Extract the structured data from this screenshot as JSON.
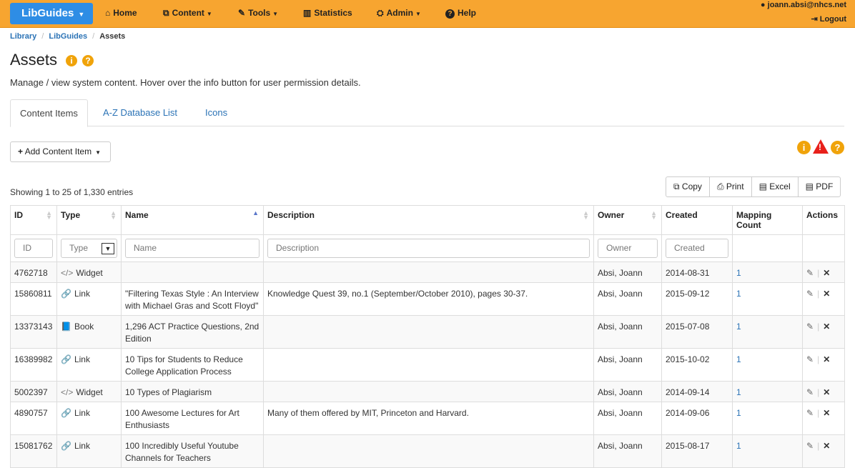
{
  "navbar": {
    "brand": "LibGuides",
    "items": [
      {
        "label": "Home",
        "icon": "home-icon",
        "glyph": "⌂"
      },
      {
        "label": "Content",
        "icon": "content-icon",
        "glyph": "⧉",
        "caret": true
      },
      {
        "label": "Tools",
        "icon": "wrench-icon",
        "glyph": "✎",
        "caret": true
      },
      {
        "label": "Statistics",
        "icon": "bar-chart-icon",
        "glyph": "▥"
      },
      {
        "label": "Admin",
        "icon": "sitemap-icon",
        "glyph": "⛭",
        "caret": true
      },
      {
        "label": "Help",
        "icon": "help-icon",
        "glyph": "?"
      }
    ],
    "user_email": "joann.absi@nhcs.net",
    "logout_label": "Logout"
  },
  "breadcrumb": [
    "Library",
    "LibGuides",
    "Assets"
  ],
  "page": {
    "title": "Assets",
    "subtitle": "Manage / view system content. Hover over the info button for user permission details."
  },
  "tabs": [
    "Content Items",
    "A-Z Database List",
    "Icons"
  ],
  "add_button_label": "Add Content Item",
  "showing_text": "Showing 1 to 25 of 1,330 entries",
  "export_buttons": [
    {
      "label": "Copy",
      "glyph": "⧉"
    },
    {
      "label": "Print",
      "glyph": "⎙"
    },
    {
      "label": "Excel",
      "glyph": "▤"
    },
    {
      "label": "PDF",
      "glyph": "▤"
    }
  ],
  "table": {
    "headers": [
      "ID",
      "Type",
      "Name",
      "Description",
      "Owner",
      "Created",
      "Mapping Count",
      "Actions"
    ],
    "filters": {
      "id": "ID",
      "type": "Type",
      "name": "Name",
      "description": "Description",
      "owner": "Owner",
      "created": "Created"
    },
    "rows": [
      {
        "id": "4762718",
        "type": "Widget",
        "type_glyph": "</>",
        "name": "",
        "description": "",
        "owner": "Absi, Joann",
        "created": "2014-08-31",
        "count": "1"
      },
      {
        "id": "15860811",
        "type": "Link",
        "type_glyph": "🔗",
        "name": "\"Filtering Texas Style : An Interview with Michael Gras and Scott Floyd\"",
        "description": "Knowledge Quest 39, no.1 (September/October 2010), pages 30-37.",
        "owner": "Absi, Joann",
        "created": "2015-09-12",
        "count": "1"
      },
      {
        "id": "13373143",
        "type": "Book",
        "type_glyph": "📘",
        "name": "1,296 ACT Practice Questions, 2nd Edition",
        "description": "",
        "owner": "Absi, Joann",
        "created": "2015-07-08",
        "count": "1"
      },
      {
        "id": "16389982",
        "type": "Link",
        "type_glyph": "🔗",
        "name": "10 Tips for Students to Reduce College Application Process",
        "description": "",
        "owner": "Absi, Joann",
        "created": "2015-10-02",
        "count": "1"
      },
      {
        "id": "5002397",
        "type": "Widget",
        "type_glyph": "</>",
        "name": "10 Types of Plagiarism",
        "description": "",
        "owner": "Absi, Joann",
        "created": "2014-09-14",
        "count": "1"
      },
      {
        "id": "4890757",
        "type": "Link",
        "type_glyph": "🔗",
        "name": "100 Awesome Lectures for Art Enthusiasts",
        "description": "Many of them offered by MIT, Princeton and Harvard.",
        "owner": "Absi, Joann",
        "created": "2014-09-06",
        "count": "1"
      },
      {
        "id": "15081762",
        "type": "Link",
        "type_glyph": "🔗",
        "name": "100 Incredibly Useful Youtube Channels for Teachers",
        "description": "",
        "owner": "Absi, Joann",
        "created": "2015-08-17",
        "count": "1"
      }
    ]
  },
  "colors": {
    "navbar": "#f7a530",
    "brand": "#2e8de5",
    "link": "#2b73b6",
    "info_icon": "#f0a30a",
    "warning_icon": "#e8201b"
  }
}
